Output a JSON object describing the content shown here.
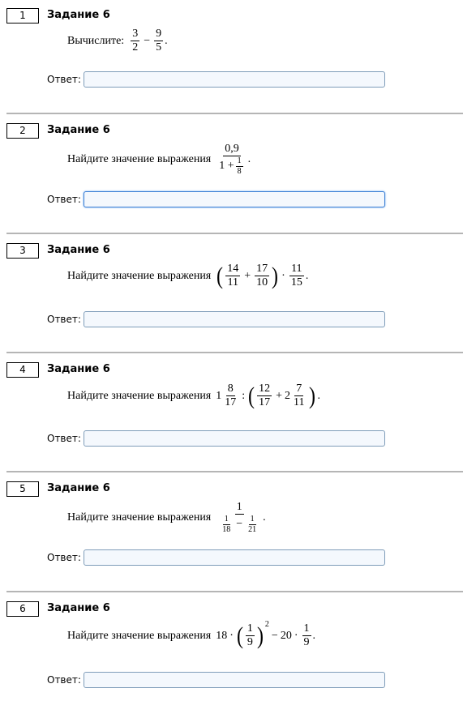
{
  "answer_label": "Ответ:",
  "tasks": [
    {
      "number": "1",
      "title": "Задание 6",
      "prompt": "Вычислите:",
      "expr": {
        "a_num": "3",
        "a_den": "2",
        "op": "−",
        "b_num": "9",
        "b_den": "5",
        "end": "."
      }
    },
    {
      "number": "2",
      "title": "Задание 6",
      "prompt": "Найдите значение выражения",
      "expr": {
        "num": "0,9",
        "den_pre": "1 +",
        "den_frac_num": "1",
        "den_frac_den": "8",
        "end": "."
      }
    },
    {
      "number": "3",
      "title": "Задание 6",
      "prompt": "Найдите значение выражения",
      "expr": {
        "lp": "(",
        "a_num": "14",
        "a_den": "11",
        "op": "+",
        "b_num": "17",
        "b_den": "10",
        "rp": ")",
        "dot": "·",
        "c_num": "11",
        "c_den": "15",
        "end": "."
      }
    },
    {
      "number": "4",
      "title": "Задание 6",
      "prompt": "Найдите значение выражения",
      "expr": {
        "w1": "1",
        "a_num": "8",
        "a_den": "17",
        "colon": ":",
        "lp": "(",
        "b_num": "12",
        "b_den": "17",
        "op": "+",
        "w2": "2",
        "c_num": "7",
        "c_den": "11",
        "rp": ")",
        "end": "."
      }
    },
    {
      "number": "5",
      "title": "Задание 6",
      "prompt": "Найдите значение выражения",
      "expr": {
        "num": "1",
        "d_a_num": "1",
        "d_a_den": "18",
        "op": "−",
        "d_b_num": "1",
        "d_b_den": "21",
        "end": "."
      }
    },
    {
      "number": "6",
      "title": "Задание 6",
      "prompt": "Найдите значение выражения",
      "expr": {
        "k": "18",
        "dot1": "·",
        "lp": "(",
        "a_num": "1",
        "a_den": "9",
        "rp": ")",
        "pow": "2",
        "op": "−",
        "m": "20",
        "dot2": "·",
        "b_num": "1",
        "b_den": "9",
        "end": "."
      }
    }
  ]
}
